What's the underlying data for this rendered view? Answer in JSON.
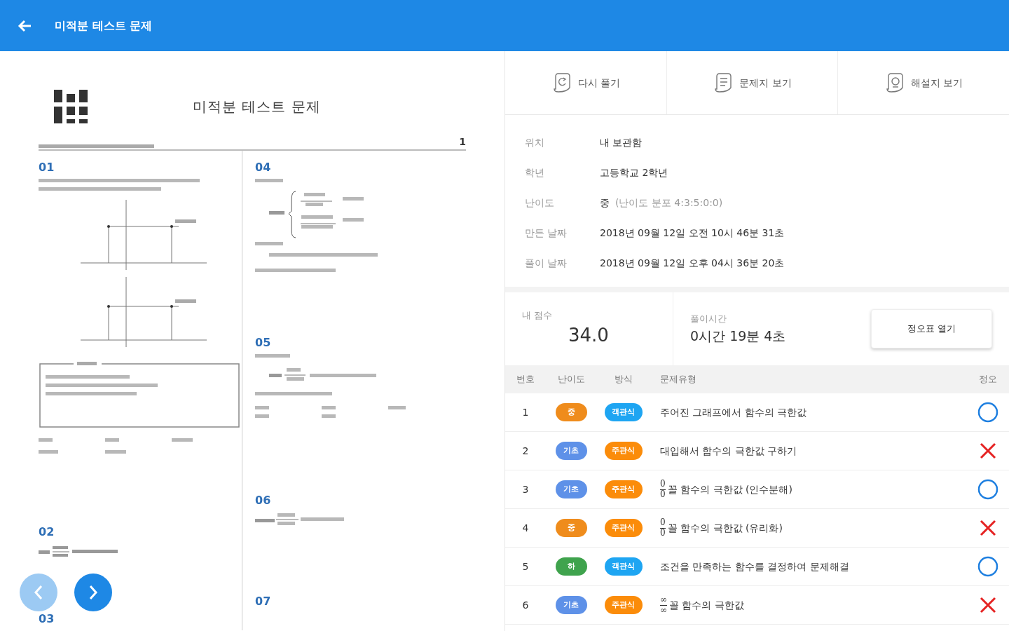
{
  "app_bar": {
    "title": "미적분 테스트 문제"
  },
  "document": {
    "title": "미적분 테스트 문제",
    "page_number": "1",
    "columns": [
      [
        {
          "number": "01",
          "kind": "graphs"
        },
        {
          "number": "02",
          "kind": "limit"
        },
        {
          "number": "03",
          "kind": "cut"
        }
      ],
      [
        {
          "number": "04",
          "kind": "piecewise"
        },
        {
          "number": "05",
          "kind": "choices"
        },
        {
          "number": "06",
          "kind": "fraction"
        },
        {
          "number": "07",
          "kind": "cut"
        }
      ]
    ]
  },
  "pager": {
    "prev_disabled": true,
    "next_disabled": false
  },
  "actions": [
    {
      "label": "다시 풀기"
    },
    {
      "label": "문제지 보기"
    },
    {
      "label": "해설지 보기"
    }
  ],
  "info": [
    {
      "label": "위치",
      "value": "내 보관함"
    },
    {
      "label": "학년",
      "value": "고등학교 2학년"
    },
    {
      "label": "난이도",
      "value": "중",
      "note": "(난이도 분포 4:3:5:0:0)"
    },
    {
      "label": "만든 날짜",
      "value": "2018년 09월 12일 오전 10시 46분 31초"
    },
    {
      "label": "풀이 날짜",
      "value": "2018년 09월 12일 오후 04시 36분 20초"
    }
  ],
  "score": {
    "label": "내 점수",
    "value": "34.0"
  },
  "time": {
    "label": "풀이시간",
    "value": "0시간 19분 4초"
  },
  "answer_sheet_button": "정오표 열기",
  "table": {
    "columns": [
      "번호",
      "난이도",
      "방식",
      "문제유형",
      "정오"
    ],
    "rows": [
      {
        "number": "1",
        "difficulty": {
          "label": "중",
          "color": "#ef8c1c"
        },
        "method": {
          "label": "객관식",
          "color": "#1ea5f2"
        },
        "type": "주어진 그래프에서 함수의 극한값",
        "correct": true
      },
      {
        "number": "2",
        "difficulty": {
          "label": "기초",
          "color": "#5e91e8"
        },
        "method": {
          "label": "주관식",
          "color": "#fb8c0a"
        },
        "type": "대입해서 함수의 극한값 구하기",
        "correct": false
      },
      {
        "number": "3",
        "difficulty": {
          "label": "기초",
          "color": "#5e91e8"
        },
        "method": {
          "label": "주관식",
          "color": "#fb8c0a"
        },
        "fraction": {
          "numerator": "0",
          "denominator": "0"
        },
        "type": "꼴 함수의 극한값 (인수분해)",
        "correct": true
      },
      {
        "number": "4",
        "difficulty": {
          "label": "중",
          "color": "#ef8c1c"
        },
        "method": {
          "label": "주관식",
          "color": "#fb8c0a"
        },
        "fraction": {
          "numerator": "0",
          "denominator": "0"
        },
        "type": "꼴 함수의 극한값 (유리화)",
        "correct": false
      },
      {
        "number": "5",
        "difficulty": {
          "label": "하",
          "color": "#3fa34d"
        },
        "method": {
          "label": "객관식",
          "color": "#1ea5f2"
        },
        "type": "조건을 만족하는 함수를 결정하여 문제해결",
        "correct": true
      },
      {
        "number": "6",
        "difficulty": {
          "label": "기초",
          "color": "#5e91e8"
        },
        "method": {
          "label": "주관식",
          "color": "#fb8c0a"
        },
        "fraction": {
          "numerator": "∞",
          "denominator": "∞"
        },
        "type": "꼴 함수의 극한값",
        "correct": false
      }
    ]
  }
}
